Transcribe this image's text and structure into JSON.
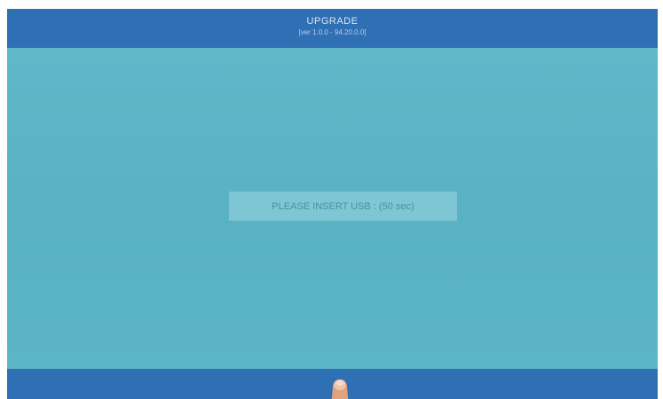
{
  "header": {
    "title": "UPGRADE",
    "version": "[ver 1.0.0 - 94.20.0.0]"
  },
  "dialog": {
    "message": "PLEASE INSERT USB : (50 sec)"
  },
  "colors": {
    "bar": "#2f6fb4",
    "background": "#5ab4c6",
    "message_box": "#7ec6d3"
  }
}
